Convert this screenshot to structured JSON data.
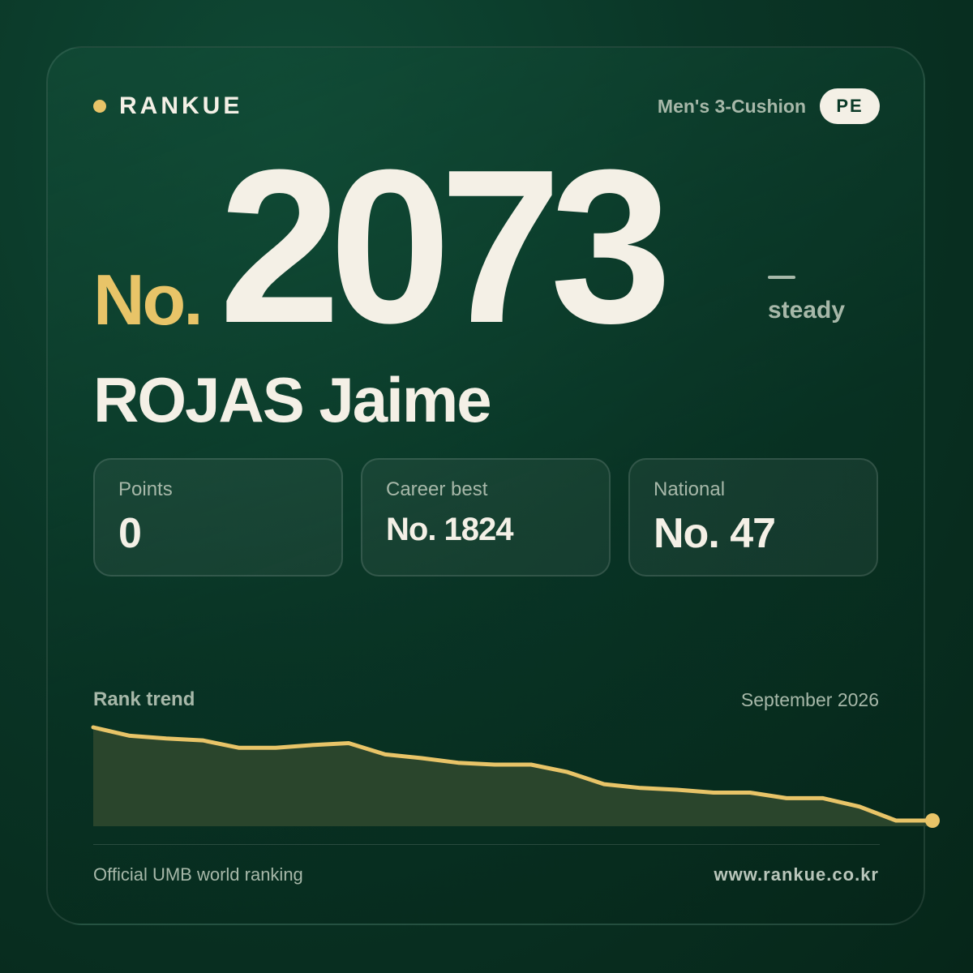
{
  "brand": {
    "name": "RANKUE"
  },
  "discipline": "Men's 3-Cushion",
  "country_code": "PE",
  "rank": {
    "prefix": "No.",
    "number": "2073",
    "movement": "steady"
  },
  "player": {
    "name": "ROJAS Jaime"
  },
  "stats": [
    {
      "label": "Points",
      "value": "0"
    },
    {
      "label": "Career best",
      "value": "No. 1824"
    },
    {
      "label": "National",
      "value": "No. 47"
    }
  ],
  "trend": {
    "label": "Rank trend",
    "date": "September 2026",
    "relative_levels": [
      1.0,
      0.91,
      0.88,
      0.86,
      0.78,
      0.78,
      0.81,
      0.83,
      0.71,
      0.67,
      0.62,
      0.6,
      0.6,
      0.52,
      0.39,
      0.35,
      0.33,
      0.3,
      0.3,
      0.24,
      0.24,
      0.15,
      0.0,
      0.0
    ]
  },
  "footer": {
    "left": "Official UMB world ranking",
    "right": "www.rankue.co.kr"
  },
  "colors": {
    "accent": "#e8c468",
    "text": "#f4f0e6",
    "muted": "#a7b8a9",
    "background": "#0a3526"
  }
}
